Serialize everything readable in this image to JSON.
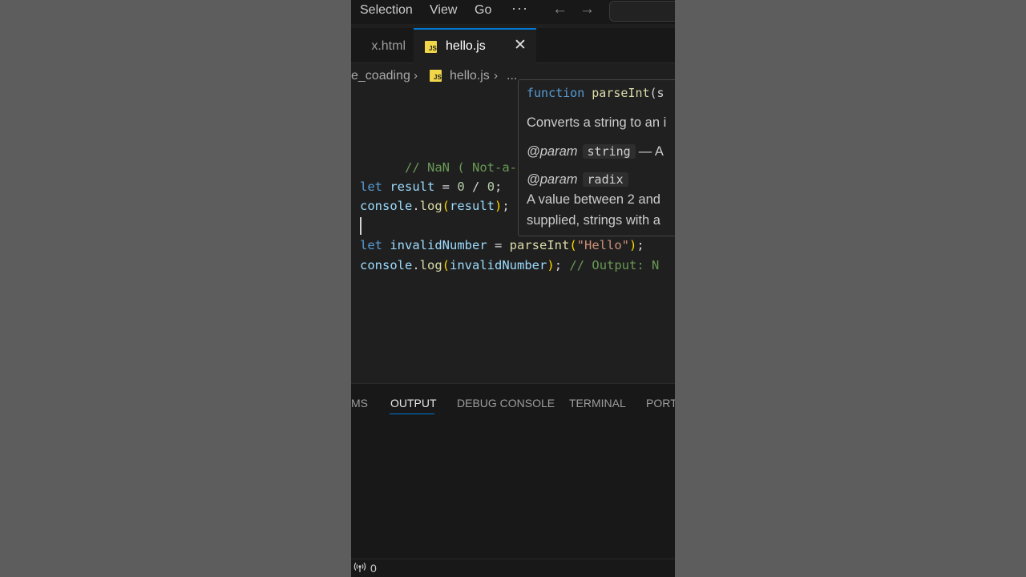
{
  "menu": {
    "items": [
      "Selection",
      "View",
      "Go"
    ],
    "more": "···",
    "back_icon": "←",
    "forward_icon": "→"
  },
  "tabs": {
    "inactive_label": "x.html",
    "active_label": "hello.js",
    "js_badge": "JS",
    "close_icon": "✕"
  },
  "breadcrumb": {
    "folder": "e_coading",
    "separator": "›",
    "file": "hello.js",
    "more": "..."
  },
  "editor": {
    "lines": [
      "// NaN ( Not-a-Number",
      "let result = 0 / 0;",
      "console.log(result);",
      "let invalidNumber = parseInt(\"Hello\");",
      "console.log(invalidNumber); // Output: N"
    ],
    "l1_comment": "// NaN ( Not-a-Number",
    "l2": {
      "kw": "let",
      "var": "result",
      "eq": " = ",
      "n1": "0",
      "div": " / ",
      "n2": "0",
      "semi": ";"
    },
    "l3": {
      "obj": "console",
      "dot": ".",
      "fn": "log",
      "open": "(",
      "arg": "result",
      "close": ")",
      "semi": ";"
    },
    "l4": {
      "kw": "let",
      "var": "invalidNumber",
      "eq": " = ",
      "fn": "parseInt",
      "open": "(",
      "str": "\"Hello\"",
      "close": ")",
      "semi": ";"
    },
    "l5": {
      "obj": "console",
      "dot": ".",
      "fn": "log",
      "open": "(",
      "arg": "invalidNumber",
      "close": ")",
      "semi": ";",
      "comment": " // Output: N"
    }
  },
  "hover": {
    "sig_kw": "function",
    "sig_fn": "parseInt",
    "sig_rest": "(s",
    "description": "Converts a string to an i",
    "param1_tag": "@param",
    "param1_name": "string",
    "param1_desc": "— A",
    "param2_tag": "@param",
    "param2_name": "radix",
    "param2_desc_line1": "A value between 2 and",
    "param2_desc_line2": "supplied, strings with a"
  },
  "panel": {
    "tabs": [
      "MS",
      "OUTPUT",
      "DEBUG CONSOLE",
      "TERMINAL",
      "PORTS"
    ],
    "active_tab": "OUTPUT"
  },
  "status": {
    "icon": "broadcast-icon",
    "count": "0"
  },
  "colors": {
    "accent": "#0078d4",
    "editor_bg": "#1f1f1f",
    "comment": "#6a9955",
    "keyword": "#569cd6",
    "js_badge": "#f1d64a"
  }
}
